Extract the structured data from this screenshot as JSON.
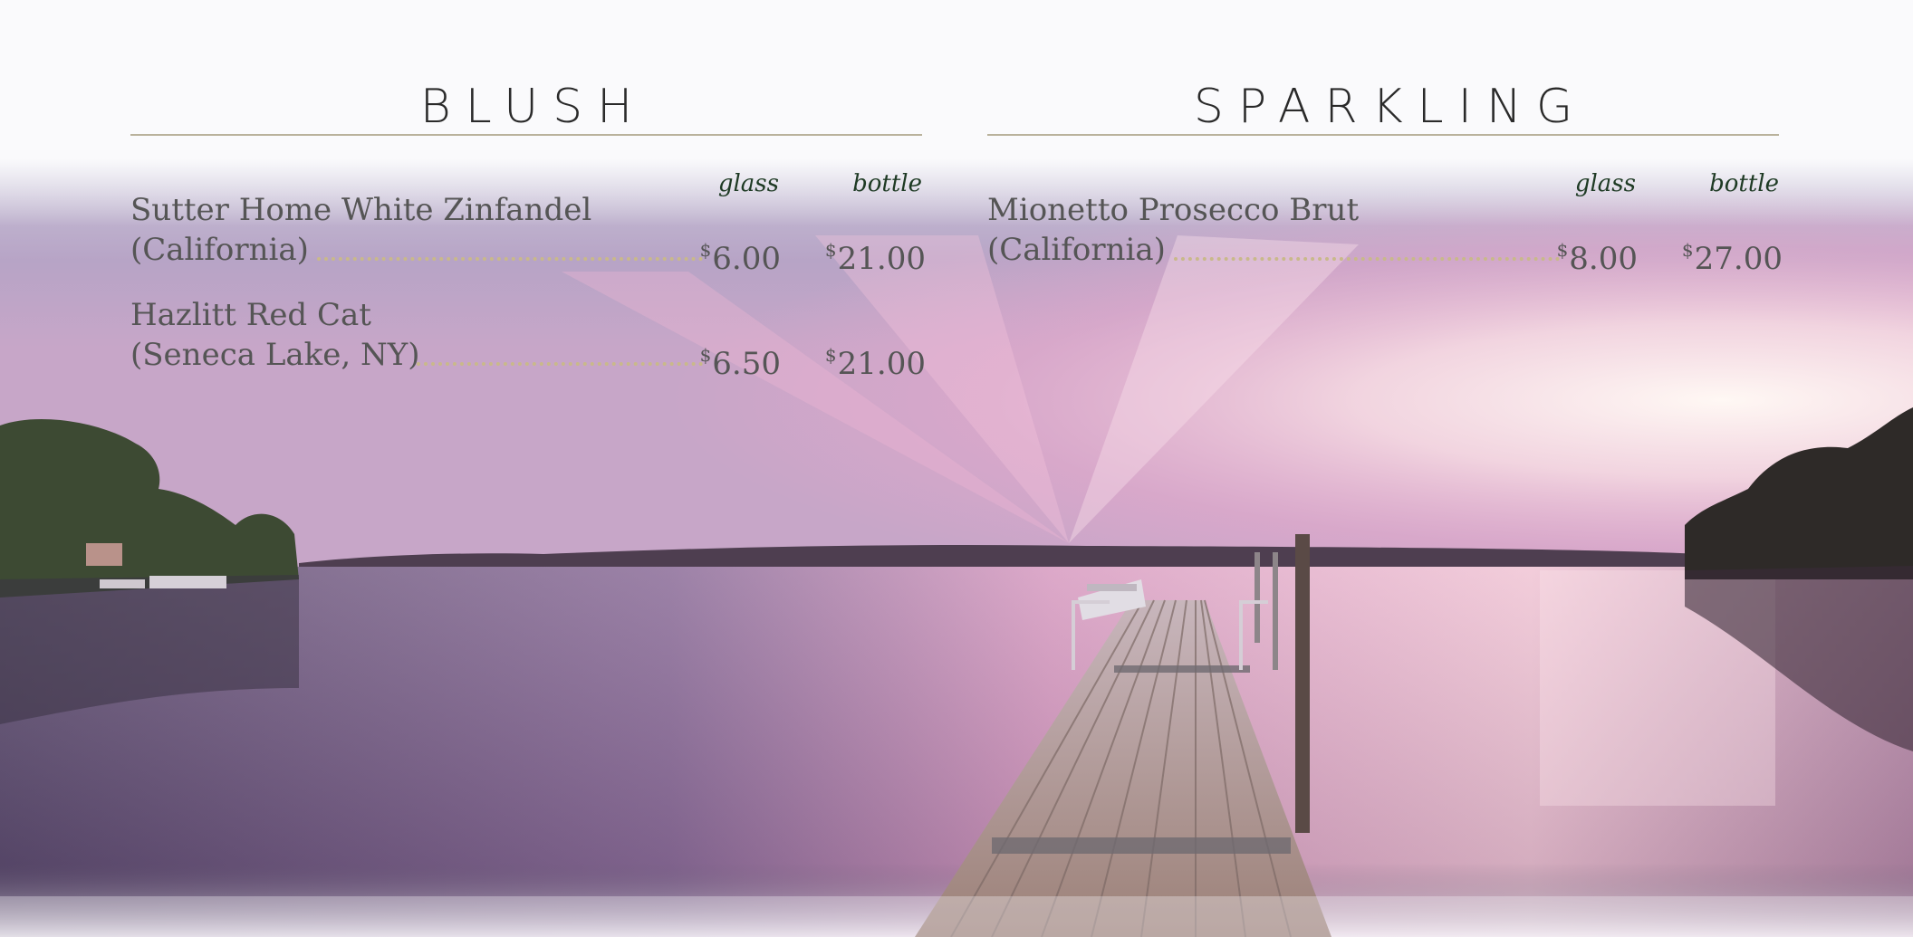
{
  "sections": [
    {
      "title": "BLUSH",
      "col_glass": "glass",
      "col_bottle": "bottle",
      "items": [
        {
          "name": "Sutter Home White Zinfandel",
          "region": "(California)",
          "currency": "$",
          "glass": "6.00",
          "bottle": "21.00"
        },
        {
          "name": "Hazlitt Red Cat",
          "region": "(Seneca Lake, NY)",
          "currency": "$",
          "glass": "6.50",
          "bottle": "21.00"
        }
      ]
    },
    {
      "title": "SPARKLING",
      "col_glass": "glass",
      "col_bottle": "bottle",
      "items": [
        {
          "name": "Mionetto Prosecco Brut",
          "region": "(California)",
          "currency": "$",
          "glass": "8.00",
          "bottle": "27.00"
        }
      ]
    }
  ],
  "colors": {
    "heading": "#2a2a2a",
    "text": "#555555",
    "column_heading": "#1e3a24",
    "rule": "#b9b29c",
    "leader_dots": "#c9b98a"
  }
}
